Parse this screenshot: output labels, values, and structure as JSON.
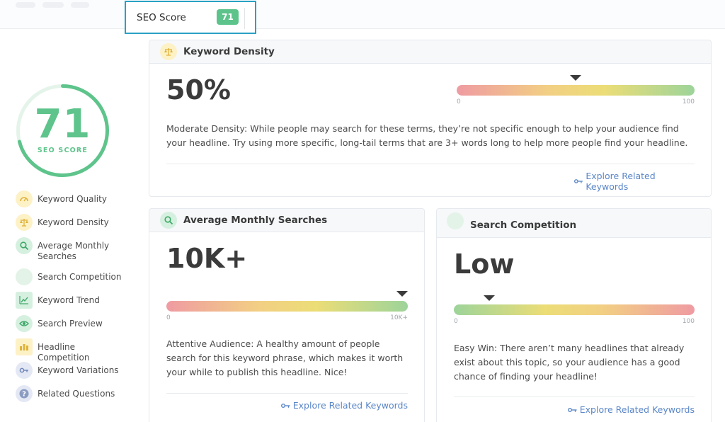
{
  "tab": {
    "label": "SEO Score",
    "score": "71"
  },
  "score": {
    "value": "71",
    "caption": "SEO SCORE",
    "fraction": 0.71,
    "color": "#5ec48b"
  },
  "sidebar": {
    "items": [
      {
        "label": "Keyword Quality",
        "icon": "gauge-icon",
        "color": "#fdf1c6"
      },
      {
        "label": "Keyword Density",
        "icon": "scale-icon",
        "color": "#fdf1c6"
      },
      {
        "label": "Average Monthly Searches",
        "icon": "magnifier-icon",
        "color": "#d6f0e0"
      },
      {
        "label": "Search Competition",
        "icon": "circle-icon",
        "color": "#e3f3e8"
      },
      {
        "label": "Keyword Trend",
        "icon": "trend-chart-icon",
        "color": "#d6f0e0"
      },
      {
        "label": "Search Preview",
        "icon": "eye-icon",
        "color": "#d6f0e0"
      },
      {
        "label": "Headline Competition",
        "icon": "bars-icon",
        "color": "#fdf1c6"
      },
      {
        "label": "Keyword Variations",
        "icon": "key-icon",
        "color": "#e3e8f4"
      },
      {
        "label": "Related Questions",
        "icon": "question-icon",
        "color": "#e3e8f4"
      }
    ]
  },
  "density": {
    "title": "Keyword Density",
    "value": "50%",
    "scale_min": "0",
    "scale_max": "100",
    "marker_fraction": 0.5,
    "description": "Moderate Density: While people may search for these terms, they’re not specific enough to help your audience find your headline. Try using more specific, long-tail terms that are 3+ words long to help more people find your headline.",
    "link": "Explore Related Keywords"
  },
  "searches": {
    "title": "Average Monthly Searches",
    "value": "10K+",
    "scale_min": "0",
    "scale_max": "10K+",
    "marker_fraction": 1.0,
    "description": "Attentive Audience: A healthy amount of people search for this keyword phrase, which makes it worth your while to publish this headline. Nice!",
    "link": "Explore Related Keywords"
  },
  "competition": {
    "title": "Search Competition",
    "value": "Low",
    "scale_min": "0",
    "scale_max": "100",
    "marker_fraction": 0.13,
    "description": "Easy Win: There aren’t many headlines that already exist about this topic, so your audience has a good chance of finding your headline!",
    "link": "Explore Related Keywords"
  }
}
